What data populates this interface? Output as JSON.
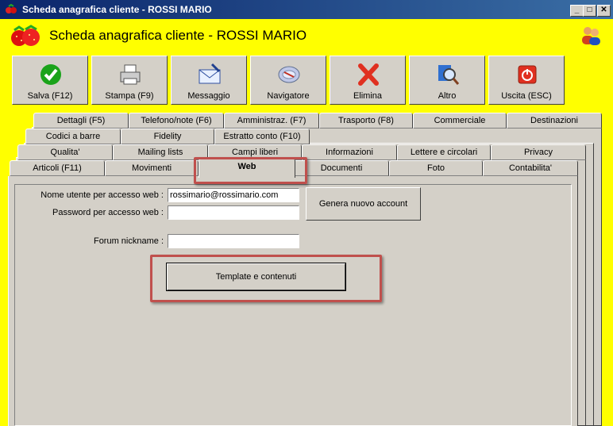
{
  "window": {
    "title": "Scheda anagrafica cliente - ROSSI MARIO",
    "minimize": "_",
    "maximize": "□",
    "close": "✕"
  },
  "header": {
    "title": "Scheda anagrafica cliente - ROSSI MARIO"
  },
  "toolbar": [
    {
      "label": "Salva (F12)",
      "icon": "check-icon"
    },
    {
      "label": "Stampa (F9)",
      "icon": "printer-icon"
    },
    {
      "label": "Messaggio",
      "icon": "envelope-icon"
    },
    {
      "label": "Navigatore",
      "icon": "compass-icon"
    },
    {
      "label": "Elimina",
      "icon": "delete-icon"
    },
    {
      "label": "Altro",
      "icon": "search-icon"
    },
    {
      "label": "Uscita (ESC)",
      "icon": "power-icon"
    }
  ],
  "tabs": {
    "row1": [
      "Dettagli (F5)",
      "Telefono/note (F6)",
      "Amministraz. (F7)",
      "Trasporto (F8)",
      "Commerciale",
      "Destinazioni"
    ],
    "row2": [
      "Codici a barre",
      "Fidelity",
      "Estratto conto (F10)"
    ],
    "row3": [
      "Qualita'",
      "Mailing lists",
      "Campi liberi",
      "Informazioni",
      "Lettere e circolari",
      "Privacy"
    ],
    "row4": [
      "Articoli (F11)",
      "Movimenti",
      "Web",
      "Documenti",
      "Foto",
      "Contabilita'"
    ],
    "selected": "Web"
  },
  "form": {
    "username_label": "Nome utente per accesso web :",
    "username_value": "rossimario@rossimario.com",
    "password_label": "Password per accesso web :",
    "password_value": "",
    "nickname_label": "Forum nickname :",
    "nickname_value": "",
    "new_account_button": "Genera nuovo account",
    "template_button": "Template e contenuti"
  }
}
